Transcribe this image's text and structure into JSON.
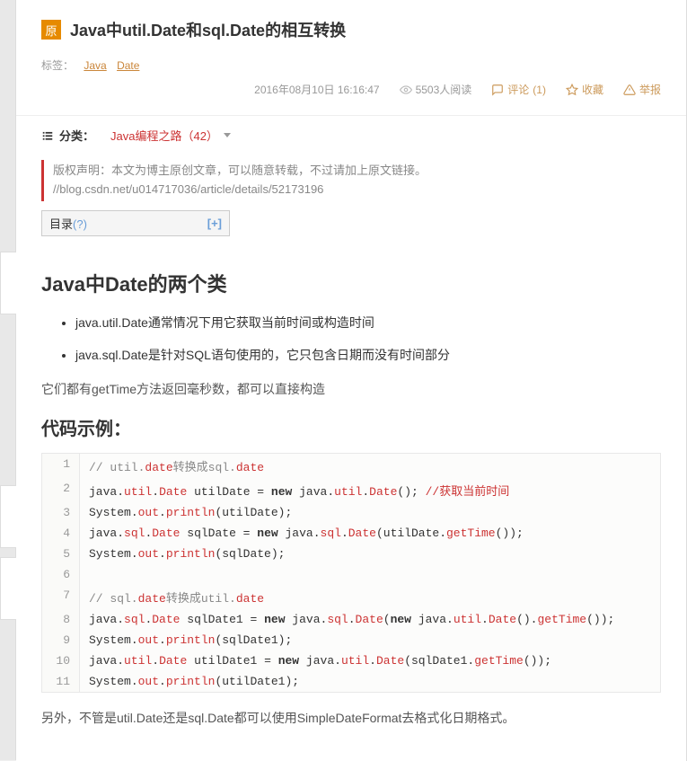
{
  "header": {
    "origin_badge": "原",
    "title": "Java中util.Date和sql.Date的相互转换",
    "tags_label": "标签：",
    "tags": [
      "Java",
      "Date"
    ]
  },
  "meta": {
    "date": "2016年08月10日 16:16:47",
    "views": "5503人阅读",
    "comments_label": "评论",
    "comments_count": "(1)",
    "favorite": "收藏",
    "report": "举报"
  },
  "category": {
    "label": "分类：",
    "value": "Java编程之路（42）"
  },
  "copyright": "版权声明：本文为博主原创文章，可以随意转载，不过请加上原文链接。 //blog.csdn.net/u014717036/article/details/52173196",
  "toc": {
    "label": "目录",
    "q": "(?)",
    "expand": "[+]"
  },
  "body": {
    "h1": "Java中Date的两个类",
    "bullets": [
      "java.util.Date通常情况下用它获取当前时间或构造时间",
      "java.sql.Date是针对SQL语句使用的，它只包含日期而没有时间部分"
    ],
    "para1": "它们都有getTime方法返回毫秒数，都可以直接构造",
    "h2": "代码示例：",
    "para2": "另外，不管是util.Date还是sql.Date都可以使用SimpleDateFormat去格式化日期格式。"
  },
  "code": {
    "lines": [
      {
        "n": "1",
        "type": "comment",
        "pre": "// util.",
        "mid": "date",
        "post": "转换成sql.",
        "mid2": "date"
      },
      {
        "n": "2",
        "raw": "java.util.Date utilDate = new java.util.Date(); //获取当前时间",
        "tokens": [
          "java",
          ".",
          "util",
          ".",
          "Date",
          " utilDate = ",
          "new",
          " java",
          ".",
          "util",
          ".",
          "Date",
          "(); ",
          "//获取当前时间"
        ]
      },
      {
        "n": "3",
        "raw": "System.out.println(utilDate);"
      },
      {
        "n": "4",
        "raw": "java.sql.Date sqlDate = new java.sql.Date(utilDate.getTime());"
      },
      {
        "n": "5",
        "raw": "System.out.println(sqlDate);"
      },
      {
        "n": "6",
        "raw": ""
      },
      {
        "n": "7",
        "type": "comment",
        "pre": "// sql.",
        "mid": "date",
        "post": "转换成util.",
        "mid2": "date"
      },
      {
        "n": "8",
        "raw": "java.sql.Date sqlDate1 = new java.sql.Date(new java.util.Date().getTime());"
      },
      {
        "n": "9",
        "raw": "System.out.println(sqlDate1);"
      },
      {
        "n": "10",
        "raw": "java.util.Date utilDate1 = new java.util.Date(sqlDate1.getTime());"
      },
      {
        "n": "11",
        "raw": "System.out.println(utilDate1);"
      }
    ]
  }
}
